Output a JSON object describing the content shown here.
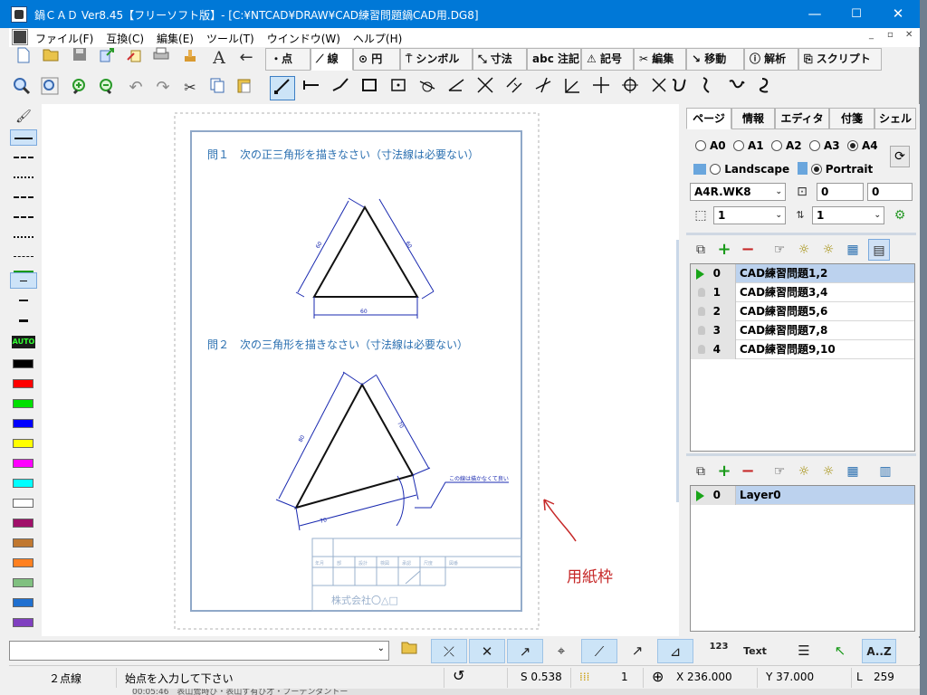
{
  "window": {
    "title": "鍋ＣＡＤ Ver8.45【フリーソフト版】- [C:¥NTCAD¥DRAW¥CAD練習問題鍋CAD用.DG8]",
    "controls": {
      "minimize": "—",
      "maximize": "☐",
      "close": "✕"
    }
  },
  "menu": {
    "items": [
      "ファイル(F)",
      "互換(C)",
      "編集(E)",
      "ツール(T)",
      "ウインドウ(W)",
      "ヘルプ(H)"
    ],
    "mdi": {
      "minimize": "_",
      "restore": "▫",
      "close": "✕"
    }
  },
  "toolbar1": {
    "tabs": [
      "・点",
      "⟋ 線",
      "⊙ 円",
      "シンボル",
      "寸法",
      "abc 注記",
      "記号",
      "編集",
      "移動",
      "ⓘ 解析",
      "スクリプト"
    ],
    "active_tab": "⟋ 線"
  },
  "drawing": {
    "q1": "問１　次の正三角形を描きなさい（寸法線は必要ない）",
    "q2": "問２　次の三角形を描きなさい（寸法線は必要ない）",
    "dim_60a": "60",
    "dim_60b": "60",
    "dim_60c": "60",
    "dim_80": "80",
    "dim_70a": "70",
    "dim_70b": "70",
    "note": "この線は描かなくて良い",
    "company": "株式会社〇△□",
    "paper_label": "用紙枠",
    "table_headers": [
      "年月",
      "部",
      "設計",
      "検図",
      "承認",
      "尺度",
      "図番"
    ]
  },
  "right_panel": {
    "tabs": [
      "ページ",
      "情報",
      "エディタ",
      "付箋",
      "シェル"
    ],
    "active_tab": "ページ",
    "sizes": [
      "A0",
      "A1",
      "A2",
      "A3",
      "A4"
    ],
    "selected_size": "A4",
    "orient": [
      "Landscape",
      "Portrait"
    ],
    "selected_orient": "Portrait",
    "template": "A4R.WK8",
    "off_x": "0",
    "off_y": "0",
    "sel1": "1",
    "sel2": "1",
    "pages": [
      {
        "num": "0",
        "name": "CAD練習問題1,2",
        "current": true
      },
      {
        "num": "1",
        "name": "CAD練習問題3,4",
        "current": false
      },
      {
        "num": "2",
        "name": "CAD練習問題5,6",
        "current": false
      },
      {
        "num": "3",
        "name": "CAD練習問題7,8",
        "current": false
      },
      {
        "num": "4",
        "name": "CAD練習問題9,10",
        "current": false
      }
    ],
    "layers": [
      {
        "num": "0",
        "name": "Layer0",
        "current": true
      }
    ]
  },
  "bottom_bar": {
    "text_btn": "Text",
    "az_btn": "A..Z",
    "num_btn": "123"
  },
  "status": {
    "mode": "２点線",
    "prompt": "始点を入力して下さい",
    "scale": "S 0.538",
    "snap": "1",
    "x": "X 236.000",
    "y": "Y 37.000",
    "len_label": "L",
    "len": "259"
  },
  "colors": {
    "titlebar": "#0078d7",
    "question_text": "#2a6fb0",
    "dimension": "#1a2ab0",
    "annotation_red": "#c62828",
    "swatches": [
      "#000000",
      "#ff0000",
      "#00e000",
      "#0000ff",
      "#ffff00",
      "#ff00ff",
      "#00ffff",
      "#ffffff",
      "#a0106a",
      "#c07830",
      "#ff8020",
      "#80c080",
      "#2070d0",
      "#8040c0"
    ]
  },
  "taskbar_peek": "00:05:46　表山鶯時び・表山ず有び才・プーテンダントー"
}
